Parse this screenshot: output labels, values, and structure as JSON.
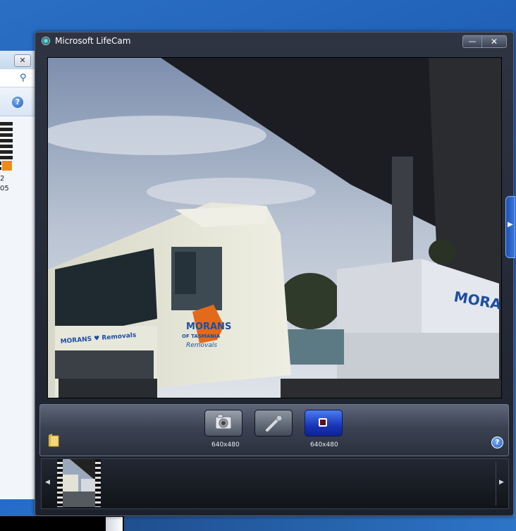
{
  "background_window": {
    "close_glyph": "✕",
    "search_icon": "⚲",
    "help_glyph": "?",
    "file_line1": "2",
    "file_line2": "05"
  },
  "window": {
    "title": "Microsoft LifeCam",
    "minimize_glyph": "—",
    "close_glyph": "✕"
  },
  "viewport": {
    "truck_text_1": "MORANS",
    "truck_text_2": "OF TASMANIA",
    "truck_text_3": "Removals",
    "truck_text_4": "MORANS ♥ Removals",
    "trailer_text": "MORANS"
  },
  "side_tab": {
    "arrow": "▶"
  },
  "controls": {
    "photo_resolution": "640x480",
    "video_resolution": "640x480",
    "help_glyph": "?"
  },
  "strip": {
    "left_arrow": "◀",
    "right_arrow": "▶"
  },
  "icons": {
    "camera": "camera-icon",
    "microphone": "microphone-icon",
    "record": "record-stop-icon",
    "folder": "folder-icon"
  },
  "colors": {
    "record_button": "#1a35b8",
    "window_frame": "#2e3442"
  }
}
